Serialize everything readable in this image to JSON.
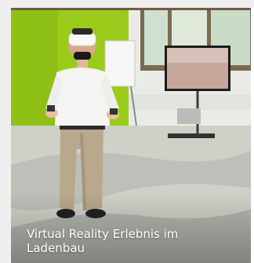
{
  "card": {
    "caption": "Virtual Reality Erlebnis im Ladenbau"
  },
  "colors": {
    "wall_green": "#9acb1a",
    "floor": "#cfd1c8",
    "shirt": "#f4f4f2",
    "pants": "#b8a98c"
  },
  "icons": [
    "vr-headset-icon",
    "tv-screen-icon",
    "flipchart-icon"
  ]
}
